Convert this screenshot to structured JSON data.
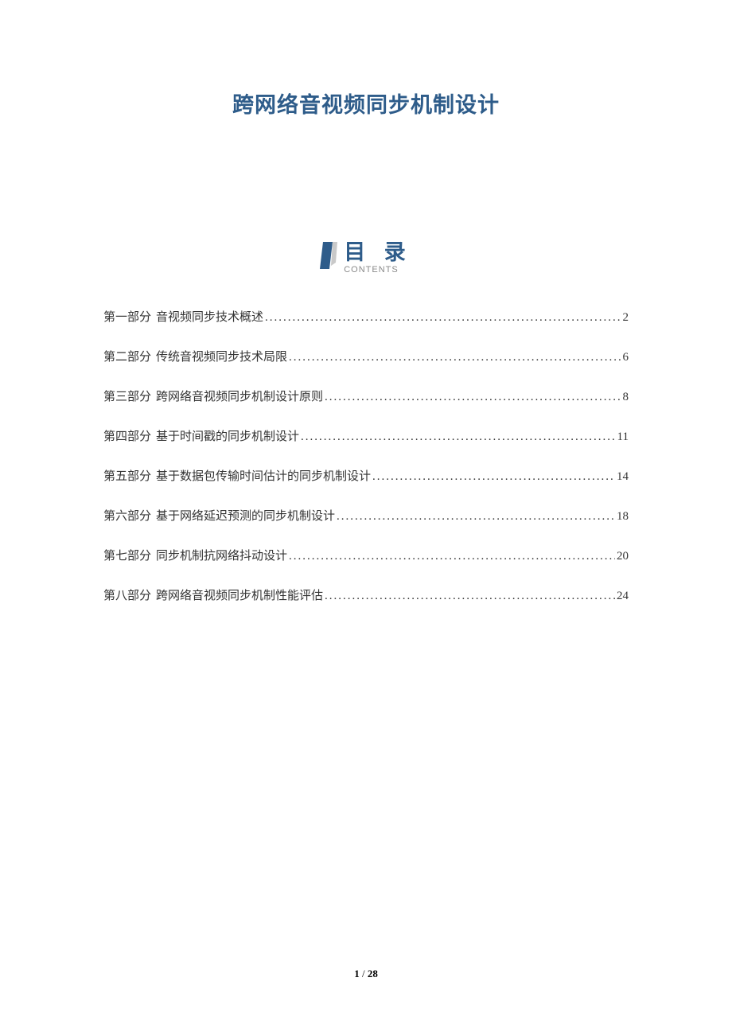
{
  "title": "跨网络音视频同步机制设计",
  "toc": {
    "heading_zh": "目 录",
    "heading_en": "CONTENTS",
    "entries": [
      {
        "part": "第一部分",
        "name": "音视频同步技术概述",
        "page": "2"
      },
      {
        "part": "第二部分",
        "name": "传统音视频同步技术局限",
        "page": "6"
      },
      {
        "part": "第三部分",
        "name": "跨网络音视频同步机制设计原则",
        "page": "8"
      },
      {
        "part": "第四部分",
        "name": "基于时间戳的同步机制设计",
        "page": "11"
      },
      {
        "part": "第五部分",
        "name": "基于数据包传输时间估计的同步机制设计",
        "page": "14"
      },
      {
        "part": "第六部分",
        "name": "基于网络延迟预测的同步机制设计",
        "page": "18"
      },
      {
        "part": "第七部分",
        "name": "同步机制抗网络抖动设计",
        "page": "20"
      },
      {
        "part": "第八部分",
        "name": "跨网络音视频同步机制性能评估",
        "page": "24"
      }
    ]
  },
  "footer": {
    "current": "1",
    "sep": " / ",
    "total": "28"
  }
}
